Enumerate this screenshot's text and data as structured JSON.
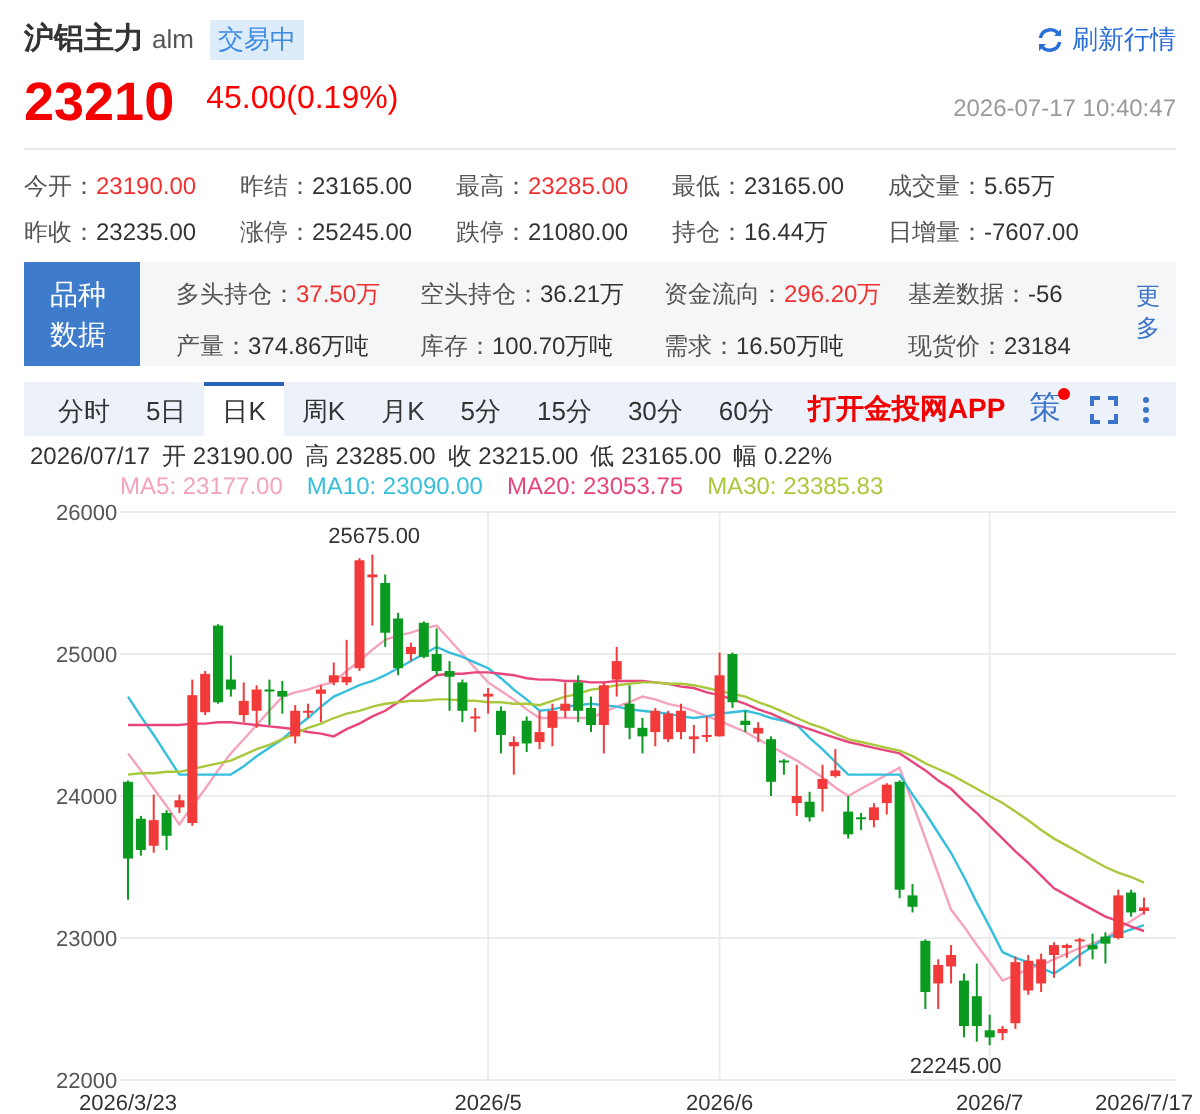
{
  "header": {
    "name": "沪铝主力",
    "code": "alm",
    "status_badge": "交易中",
    "refresh_label": "刷新行情"
  },
  "quote": {
    "price": "23210",
    "change": "45.00(0.19%)",
    "timestamp": "2026-07-17 10:40:47"
  },
  "stats": [
    {
      "label": "今开：",
      "value": "23190.00",
      "up": true
    },
    {
      "label": "昨结：",
      "value": "23165.00",
      "up": false
    },
    {
      "label": "最高：",
      "value": "23285.00",
      "up": true
    },
    {
      "label": "最低：",
      "value": "23165.00",
      "up": false
    },
    {
      "label": "成交量：",
      "value": "5.65万",
      "up": false
    },
    {
      "label": "昨收：",
      "value": "23235.00",
      "up": false
    },
    {
      "label": "涨停：",
      "value": "25245.00",
      "up": false
    },
    {
      "label": "跌停：",
      "value": "21080.00",
      "up": false
    },
    {
      "label": "持仓：",
      "value": "16.44万",
      "up": false
    },
    {
      "label": "日增量：",
      "value": "-7607.00",
      "up": false
    }
  ],
  "variety": {
    "title": "品种数据",
    "more": "更多",
    "items": [
      {
        "label": "多头持仓：",
        "value": "37.50万",
        "up": true
      },
      {
        "label": "空头持仓：",
        "value": "36.21万",
        "up": false
      },
      {
        "label": "资金流向：",
        "value": "296.20万",
        "up": true
      },
      {
        "label": "基差数据：",
        "value": "-56",
        "up": false
      },
      {
        "label": "产量：",
        "value": "374.86万吨",
        "up": false
      },
      {
        "label": "库存：",
        "value": "100.70万吨",
        "up": false
      },
      {
        "label": "需求：",
        "value": "16.50万吨",
        "up": false
      },
      {
        "label": "现货价：",
        "value": "23184",
        "up": false
      }
    ]
  },
  "tabs": [
    {
      "label": "分时",
      "selected": false
    },
    {
      "label": "5日",
      "selected": false
    },
    {
      "label": "日K",
      "selected": true
    },
    {
      "label": "周K",
      "selected": false
    },
    {
      "label": "月K",
      "selected": false
    },
    {
      "label": "5分",
      "selected": false
    },
    {
      "label": "15分",
      "selected": false
    },
    {
      "label": "30分",
      "selected": false
    },
    {
      "label": "60分",
      "selected": false
    }
  ],
  "app_link": "打开金投网APP",
  "strategy_button": {
    "label": "策",
    "has_dot": true
  },
  "day_info": [
    {
      "label": "2026/07/17"
    },
    {
      "label": "开",
      "value": "23190.00"
    },
    {
      "label": "高",
      "value": "23285.00"
    },
    {
      "label": "收",
      "value": "23215.00"
    },
    {
      "label": "低",
      "value": "23165.00"
    },
    {
      "label": "幅",
      "value": "0.22%"
    }
  ],
  "moving_averages": [
    {
      "value": ": 23177.00"
    },
    {
      "value": ": 23090.00"
    },
    {
      "value": ": 23053.75"
    },
    {
      "value": ": 23385.83"
    }
  ],
  "chart": {
    "high_label": "25675.00",
    "low_label": "22245.00",
    "chart_data": {
      "type": "candlestick",
      "grid": true,
      "ylim": [
        22000,
        26000
      ],
      "yticks": [
        {
          "value": 26000,
          "label": "26000"
        },
        {
          "value": 25000,
          "label": "25000"
        },
        {
          "value": 24000,
          "label": "24000"
        },
        {
          "value": 23000,
          "label": "23000"
        },
        {
          "value": 22000,
          "label": "22000"
        }
      ],
      "categories": [
        "2026/3/23",
        null,
        null,
        null,
        null,
        null,
        null,
        null,
        null,
        null,
        null,
        null,
        null,
        null,
        null,
        null,
        null,
        null,
        null,
        null,
        null,
        null,
        null,
        null,
        null,
        null,
        null,
        null,
        "2026/5",
        null,
        null,
        null,
        null,
        null,
        null,
        null,
        null,
        null,
        null,
        null,
        null,
        null,
        null,
        null,
        null,
        null,
        "2026/6",
        null,
        null,
        null,
        null,
        null,
        null,
        null,
        null,
        null,
        null,
        null,
        null,
        null,
        null,
        null,
        null,
        null,
        null,
        null,
        null,
        "2026/7",
        null,
        null,
        null,
        null,
        null,
        null,
        null,
        null,
        null,
        null,
        null,
        "2026/7/17"
      ],
      "ohlc": [
        [
          24100,
          24110,
          23270,
          23560
        ],
        [
          23840,
          23860,
          23580,
          23620
        ],
        [
          23650,
          24010,
          23600,
          23830
        ],
        [
          23880,
          23900,
          23620,
          23720
        ],
        [
          23920,
          24010,
          23880,
          23970
        ],
        [
          23810,
          24820,
          23790,
          24710
        ],
        [
          24590,
          24880,
          24570,
          24860
        ],
        [
          25200,
          25210,
          24650,
          24660
        ],
        [
          24820,
          24990,
          24700,
          24750
        ],
        [
          24570,
          24800,
          24520,
          24670
        ],
        [
          24600,
          24780,
          24480,
          24750
        ],
        [
          24750,
          24820,
          24500,
          24740
        ],
        [
          24740,
          24810,
          24580,
          24700
        ],
        [
          24420,
          24640,
          24370,
          24600
        ],
        [
          24590,
          24650,
          24550,
          24600
        ],
        [
          24720,
          24780,
          24520,
          24750
        ],
        [
          24800,
          24940,
          24780,
          24850
        ],
        [
          24800,
          25100,
          24780,
          24840
        ],
        [
          24900,
          25675,
          24880,
          25660
        ],
        [
          25540,
          25700,
          25200,
          25560
        ],
        [
          25500,
          25560,
          25050,
          25150
        ],
        [
          25250,
          25290,
          24850,
          24900
        ],
        [
          25000,
          25080,
          24950,
          25050
        ],
        [
          25220,
          25230,
          24970,
          24980
        ],
        [
          25000,
          25180,
          24850,
          24880
        ],
        [
          24880,
          24950,
          24600,
          24840
        ],
        [
          24800,
          24820,
          24520,
          24600
        ],
        [
          24550,
          24620,
          24450,
          24560
        ],
        [
          24700,
          24760,
          24580,
          24720
        ],
        [
          24600,
          24630,
          24300,
          24430
        ],
        [
          24350,
          24420,
          24150,
          24380
        ],
        [
          24530,
          24560,
          24310,
          24370
        ],
        [
          24380,
          24600,
          24330,
          24450
        ],
        [
          24480,
          24650,
          24350,
          24600
        ],
        [
          24600,
          24800,
          24550,
          24650
        ],
        [
          24800,
          24850,
          24520,
          24600
        ],
        [
          24620,
          24700,
          24450,
          24500
        ],
        [
          24500,
          24800,
          24300,
          24780
        ],
        [
          24820,
          25050,
          24700,
          24950
        ],
        [
          24650,
          24780,
          24400,
          24480
        ],
        [
          24480,
          24550,
          24300,
          24420
        ],
        [
          24450,
          24620,
          24350,
          24600
        ],
        [
          24400,
          24600,
          24380,
          24580
        ],
        [
          24450,
          24650,
          24400,
          24600
        ],
        [
          24400,
          24500,
          24300,
          24420
        ],
        [
          24420,
          24560,
          24380,
          24430
        ],
        [
          24420,
          25010,
          24420,
          24850
        ],
        [
          25000,
          25010,
          24620,
          24660
        ],
        [
          24530,
          24600,
          24450,
          24500
        ],
        [
          24440,
          24520,
          24380,
          24480
        ],
        [
          24400,
          24420,
          24000,
          24100
        ],
        [
          24250,
          24260,
          24150,
          24240
        ],
        [
          23950,
          24220,
          23860,
          24000
        ],
        [
          23960,
          24030,
          23820,
          23850
        ],
        [
          24050,
          24220,
          23890,
          24120
        ],
        [
          24140,
          24330,
          24130,
          24180
        ],
        [
          23890,
          24000,
          23700,
          23730
        ],
        [
          23850,
          23880,
          23760,
          23840
        ],
        [
          23830,
          23950,
          23780,
          23920
        ],
        [
          23950,
          24090,
          23870,
          24080
        ],
        [
          24100,
          24110,
          23280,
          23340
        ],
        [
          23300,
          23380,
          23180,
          23220
        ],
        [
          22980,
          22990,
          22500,
          22620
        ],
        [
          22680,
          22850,
          22500,
          22810
        ],
        [
          22800,
          22950,
          22680,
          22880
        ],
        [
          22700,
          22750,
          22300,
          22380
        ],
        [
          22590,
          22820,
          22270,
          22380
        ],
        [
          22350,
          22460,
          22245,
          22300
        ],
        [
          22330,
          22380,
          22280,
          22360
        ],
        [
          22400,
          22870,
          22360,
          22830
        ],
        [
          22630,
          22880,
          22600,
          22840
        ],
        [
          22680,
          22890,
          22620,
          22850
        ],
        [
          22880,
          22970,
          22720,
          22950
        ],
        [
          22930,
          22960,
          22860,
          22950
        ],
        [
          22980,
          23000,
          22800,
          22990
        ],
        [
          22950,
          23030,
          22850,
          22920
        ],
        [
          23010,
          23040,
          22820,
          22960
        ],
        [
          23000,
          23340,
          22990,
          23300
        ],
        [
          23320,
          23340,
          23150,
          23180
        ],
        [
          23190,
          23285,
          23165,
          23215
        ]
      ],
      "series": [
        {
          "name": "MA5",
          "type": "line",
          "color": "#f5a3bd",
          "values": [
            24300,
            24180,
            24050,
            23930,
            23800,
            23930,
            24050,
            24180,
            24300,
            24400,
            24500,
            24600,
            24700,
            24730,
            24750,
            24780,
            24800,
            24880,
            24950,
            25030,
            25100,
            25130,
            25150,
            25180,
            25200,
            25100,
            25000,
            24900,
            24800,
            24740,
            24680,
            24610,
            24550,
            24550,
            24550,
            24550,
            24550,
            24590,
            24630,
            24660,
            24700,
            24680,
            24650,
            24630,
            24600,
            24560,
            24530,
            24490,
            24450,
            24400,
            24350,
            24300,
            24250,
            24190,
            24130,
            24060,
            24000,
            24050,
            24100,
            24150,
            24200,
            23950,
            23700,
            23450,
            23200,
            23080,
            22950,
            22830,
            22700,
            22740,
            22780,
            22810,
            22850,
            22890,
            22930,
            22960,
            23000,
            23060,
            23120,
            23180
          ]
        },
        {
          "name": "MA10",
          "type": "line",
          "color": "#35bfdc",
          "values": [
            24700,
            24560,
            24430,
            24290,
            24150,
            24150,
            24150,
            24150,
            24150,
            24210,
            24280,
            24340,
            24400,
            24480,
            24550,
            24630,
            24700,
            24740,
            24780,
            24810,
            24850,
            24900,
            24950,
            25000,
            25050,
            25010,
            24980,
            24940,
            24900,
            24830,
            24750,
            24680,
            24600,
            24610,
            24630,
            24640,
            24650,
            24640,
            24630,
            24610,
            24600,
            24590,
            24580,
            24560,
            24550,
            24560,
            24580,
            24590,
            24600,
            24580,
            24550,
            24530,
            24500,
            24410,
            24330,
            24240,
            24150,
            24150,
            24150,
            24150,
            24150,
            24010,
            23880,
            23740,
            23600,
            23430,
            23250,
            23080,
            22900,
            22860,
            22830,
            22790,
            22750,
            22810,
            22880,
            22940,
            23000,
            23030,
            23060,
            23090
          ]
        },
        {
          "name": "MA20",
          "type": "line",
          "color": "#e8457d",
          "values": [
            24500,
            24500,
            24500,
            24500,
            24500,
            24510,
            24510,
            24520,
            24520,
            24510,
            24500,
            24490,
            24480,
            24470,
            24450,
            24440,
            24420,
            24470,
            24510,
            24560,
            24600,
            24660,
            24730,
            24790,
            24850,
            24860,
            24860,
            24870,
            24870,
            24860,
            24850,
            24830,
            24820,
            24820,
            24810,
            24810,
            24800,
            24800,
            24810,
            24810,
            24810,
            24800,
            24790,
            24770,
            24760,
            24730,
            24710,
            24680,
            24650,
            24610,
            24580,
            24540,
            24500,
            24470,
            24440,
            24410,
            24380,
            24360,
            24340,
            24320,
            24300,
            24240,
            24180,
            24110,
            24050,
            23960,
            23880,
            23790,
            23700,
            23610,
            23530,
            23440,
            23350,
            23300,
            23250,
            23200,
            23150,
            23120,
            23080,
            23050
          ]
        },
        {
          "name": "MA30",
          "type": "line",
          "color": "#a9c83c",
          "values": [
            24150,
            24160,
            24160,
            24170,
            24170,
            24190,
            24210,
            24230,
            24250,
            24290,
            24330,
            24360,
            24400,
            24440,
            24480,
            24510,
            24550,
            24580,
            24600,
            24630,
            24650,
            24660,
            24670,
            24670,
            24680,
            24680,
            24670,
            24670,
            24660,
            24660,
            24650,
            24650,
            24640,
            24670,
            24700,
            24720,
            24750,
            24760,
            24780,
            24790,
            24800,
            24800,
            24790,
            24790,
            24780,
            24760,
            24740,
            24720,
            24700,
            24660,
            24630,
            24590,
            24550,
            24510,
            24480,
            24440,
            24400,
            24380,
            24360,
            24340,
            24320,
            24280,
            24230,
            24190,
            24150,
            24100,
            24050,
            24000,
            23950,
            23890,
            23830,
            23760,
            23700,
            23650,
            23600,
            23550,
            23500,
            23460,
            23430,
            23390
          ]
        }
      ]
    }
  }
}
